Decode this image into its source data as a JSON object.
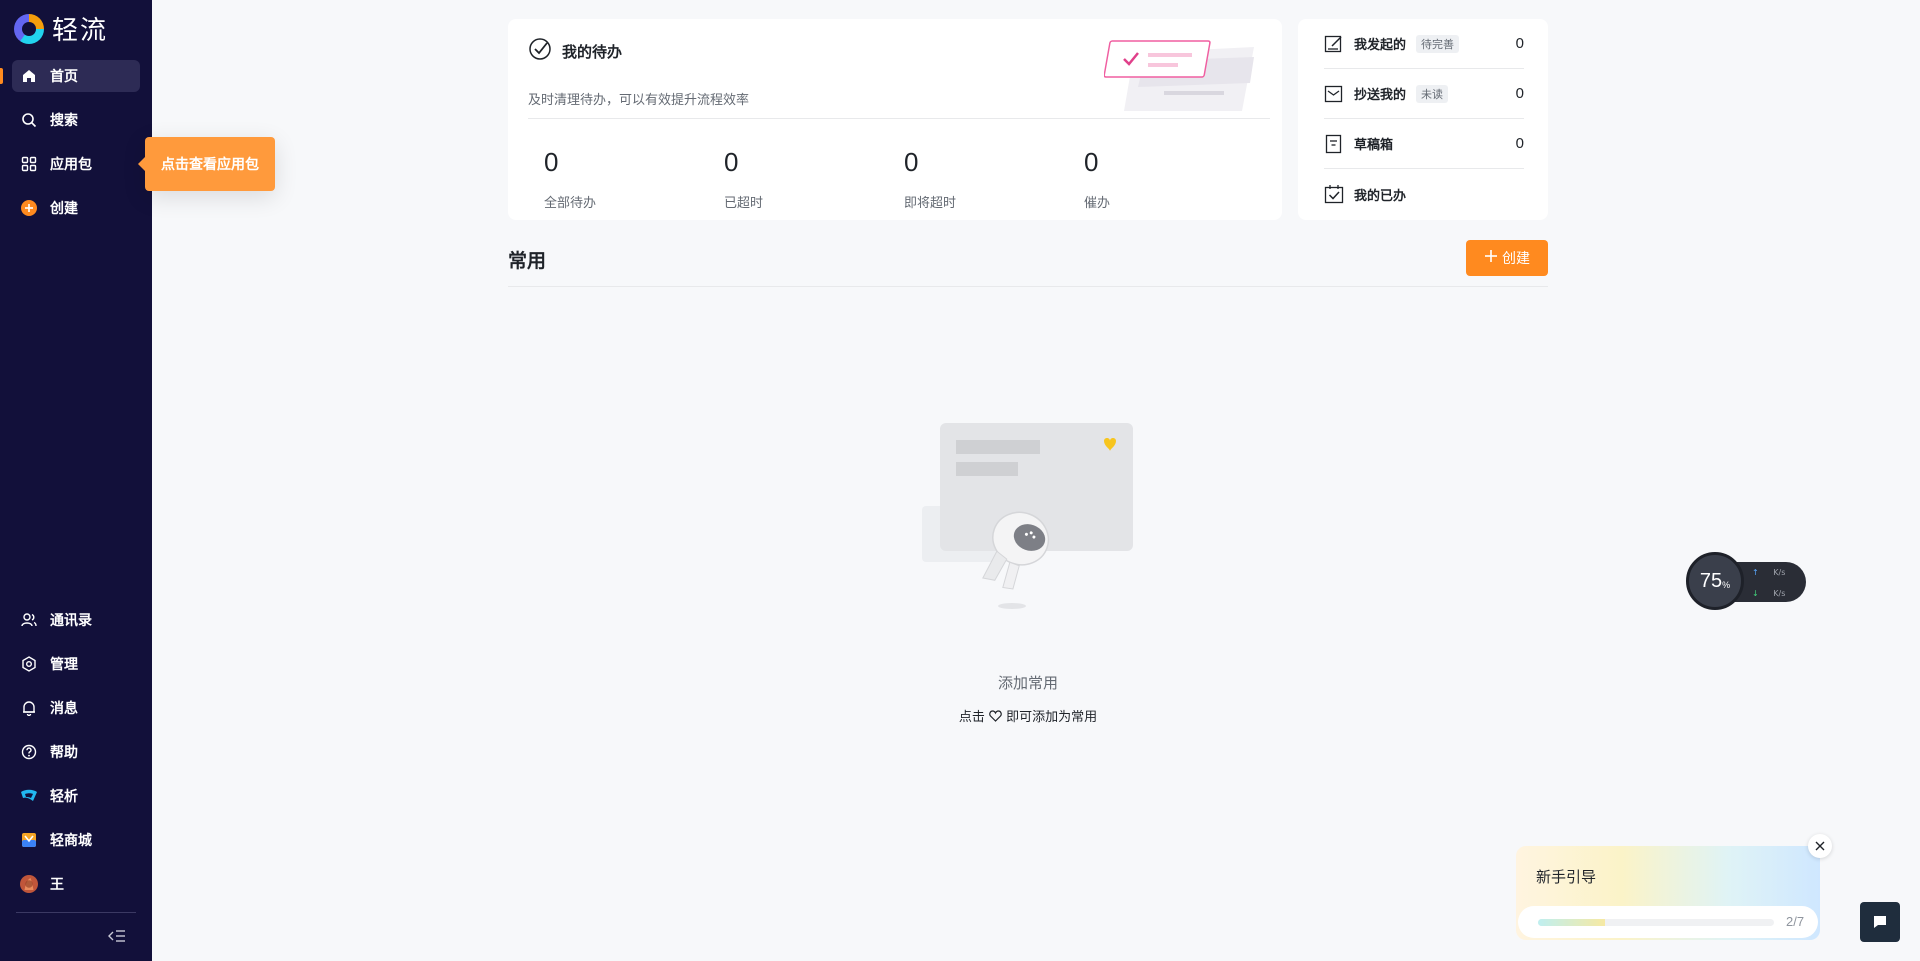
{
  "brand": {
    "name": "轻流"
  },
  "sidebar": {
    "top_items": [
      {
        "label": "首页",
        "icon": "home-icon"
      },
      {
        "label": "搜索",
        "icon": "search-icon"
      },
      {
        "label": "应用包",
        "icon": "grid-icon"
      },
      {
        "label": "创建",
        "icon": "plus-circle-icon"
      }
    ],
    "bottom_items": [
      {
        "label": "通讯录",
        "icon": "contacts-icon"
      },
      {
        "label": "管理",
        "icon": "settings-icon"
      },
      {
        "label": "消息",
        "icon": "bell-icon"
      },
      {
        "label": "帮助",
        "icon": "help-icon"
      },
      {
        "label": "轻析",
        "icon": "qingxi-icon"
      },
      {
        "label": "轻商城",
        "icon": "store-icon"
      },
      {
        "label": "王",
        "icon": "avatar"
      }
    ],
    "tooltip": "点击查看应用包"
  },
  "todo": {
    "title": "我的待办",
    "subtitle": "及时清理待办，可以有效提升流程效率",
    "stats": [
      {
        "value": "0",
        "label": "全部待办"
      },
      {
        "value": "0",
        "label": "已超时"
      },
      {
        "value": "0",
        "label": "即将超时"
      },
      {
        "value": "0",
        "label": "催办"
      }
    ]
  },
  "side": {
    "rows": [
      {
        "label": "我发起的",
        "tag": "待完善",
        "count": "0",
        "icon": "edit-icon"
      },
      {
        "label": "抄送我的",
        "tag": "未读",
        "count": "0",
        "icon": "mail-icon"
      },
      {
        "label": "草稿箱",
        "tag": "",
        "count": "0",
        "icon": "draft-icon"
      },
      {
        "label": "我的已办",
        "tag": "",
        "count": "",
        "icon": "done-icon"
      }
    ]
  },
  "common": {
    "title": "常用",
    "create_label": "创建",
    "empty_title": "添加常用",
    "empty_sub_prefix": "点击",
    "empty_sub_suffix": "即可添加为常用"
  },
  "speed": {
    "percent": "75",
    "unit": "%",
    "up": "K/s",
    "down": "K/s"
  },
  "guide": {
    "title": "新手引导",
    "step": "2/7",
    "progress": 0.286
  },
  "colors": {
    "sidebar_bg": "#12103a",
    "accent": "#ff8a1f"
  }
}
